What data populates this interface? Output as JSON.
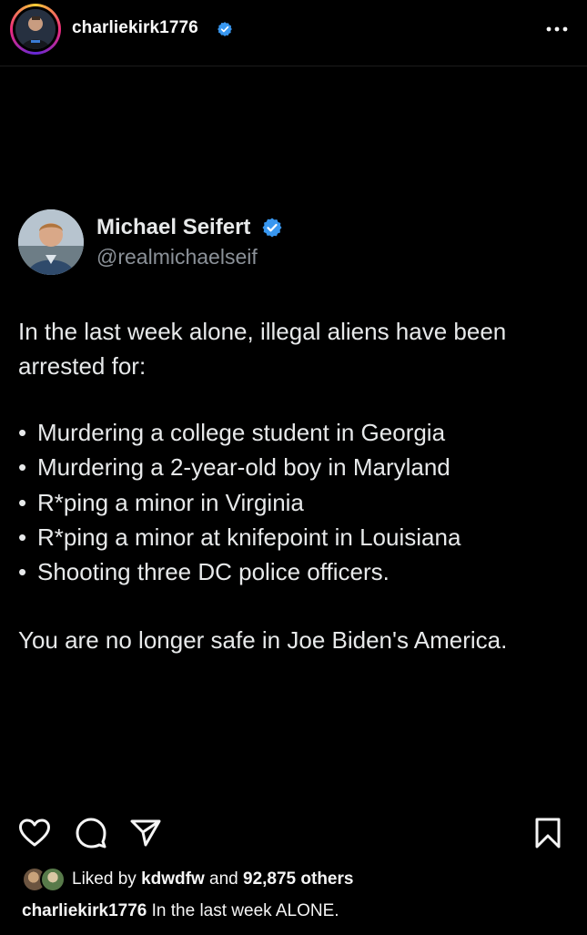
{
  "post": {
    "username": "charliekirk1776",
    "more_label": "More options"
  },
  "tweet": {
    "name": "Michael Seifert",
    "handle": "@realmichaelseif",
    "intro": "In the last week alone, illegal aliens have been arrested for:",
    "bullet_char": "•",
    "items": [
      "Murdering a college student in Georgia",
      "Murdering a 2-year-old boy in Maryland",
      "R*ping a minor in Virginia",
      "R*ping a minor at knifepoint in Louisiana",
      "Shooting three DC police officers."
    ],
    "closing": "You are no longer safe in Joe Biden's America."
  },
  "actions": {
    "like_icon": "heart-icon",
    "comment_icon": "comment-icon",
    "share_icon": "send-icon",
    "save_icon": "bookmark-icon"
  },
  "likes": {
    "prefix": "Liked by",
    "user": "kdwdfw",
    "joiner": "and",
    "count": "92,875 others"
  },
  "caption": {
    "username": "charliekirk1776",
    "text": "In the last week ALONE."
  },
  "colors": {
    "background": "#000000",
    "verified": "#3897f0",
    "text": "#f5f5f5",
    "secondary_text": "#8b9198"
  }
}
